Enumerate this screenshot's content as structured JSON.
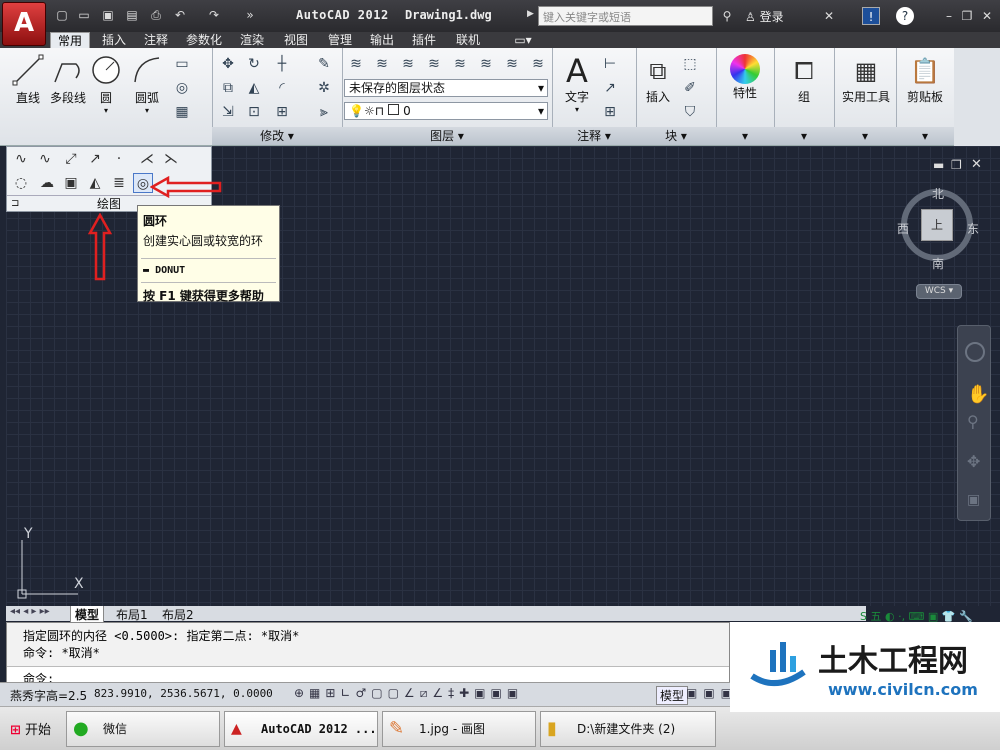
{
  "title": {
    "app": "AutoCAD 2012",
    "document": "Drawing1.dwg",
    "search_placeholder": "键入关键字或短语",
    "login": "登录"
  },
  "tabs": [
    "常用",
    "插入",
    "注释",
    "参数化",
    "渲染",
    "视图",
    "管理",
    "输出",
    "插件",
    "联机"
  ],
  "active_tab": "常用",
  "ribbon": {
    "draw_buttons": [
      "直线",
      "多段线",
      "圆",
      "圆弧"
    ],
    "modify_label": "修改",
    "layer_label": "图层",
    "layer_state": "未保存的图层状态",
    "layer_current": "0",
    "annotation_label": "注释",
    "text_button": "文字",
    "block_label": "块",
    "insert_button": "插入",
    "properties_button": "特性",
    "group_button": "组",
    "utilities_button": "实用工具",
    "clipboard_button": "剪贴板"
  },
  "draw_panel_label": "绘图",
  "tooltip": {
    "title": "圆环",
    "description": "创建实心圆或较宽的环",
    "command": "DONUT",
    "help": "按 F1 键获得更多帮助"
  },
  "viewcube": {
    "north": "北",
    "south": "南",
    "east": "东",
    "west": "西",
    "face": "上",
    "wcs": "WCS"
  },
  "ucs": {
    "x": "X",
    "y": "Y"
  },
  "layout_tabs": [
    "模型",
    "布局1",
    "布局2"
  ],
  "command_lines": [
    "指定圆环的内径 <0.5000>:  指定第二点: *取消*",
    "命令: *取消*",
    "命令:"
  ],
  "status": {
    "text_height": "燕秀字高=2.5",
    "coords": "823.9910,  2536.5671, 0.0000",
    "model": "模型"
  },
  "taskbar": {
    "start": "开始",
    "items": [
      "微信",
      "AutoCAD 2012 ...",
      "1.jpg - 画图",
      "D:\\新建文件夹 (2)"
    ]
  },
  "watermark": {
    "name": "土木工程网",
    "url": "www.civilcn.com"
  },
  "colors": {
    "accent": "#d9232d",
    "canvas": "#1f2534",
    "tooltip": "#fffee7"
  }
}
